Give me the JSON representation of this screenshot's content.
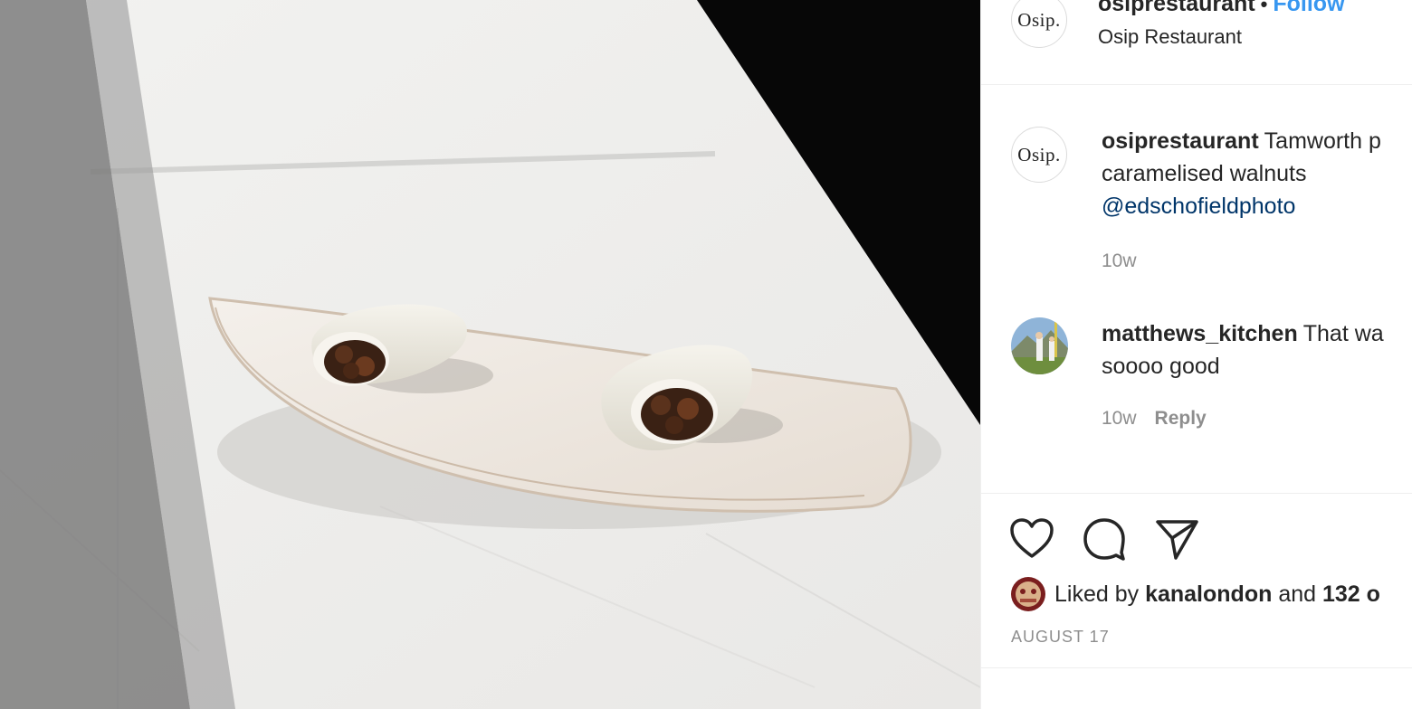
{
  "post_header": {
    "avatar_text": "Osip.",
    "username": "osiprestaurant",
    "separator": "•",
    "follow_label": "Follow",
    "location": "Osip Restaurant"
  },
  "comments": [
    {
      "avatar_text": "Osip.",
      "username": "osiprestaurant",
      "text_line1": "Tamworth p",
      "text_line2": "caramelised walnuts",
      "mention": "@edschofieldphoto",
      "time": "10w"
    },
    {
      "username": "matthews_kitchen",
      "text_line1": "That wa",
      "text_line2": "soooo good",
      "time": "10w",
      "reply_label": "Reply"
    }
  ],
  "actions": {
    "icons": [
      "heart-icon",
      "comment-icon",
      "share-icon"
    ],
    "liked_prefix": "Liked by",
    "liked_user": "kanalondon",
    "liked_and": "and",
    "liked_count": "132 o",
    "date": "AUGUST 17"
  },
  "colors": {
    "link_blue": "#3897f0",
    "mention_blue": "#003569",
    "muted_gray": "#8e8e8e",
    "text": "#262626"
  }
}
